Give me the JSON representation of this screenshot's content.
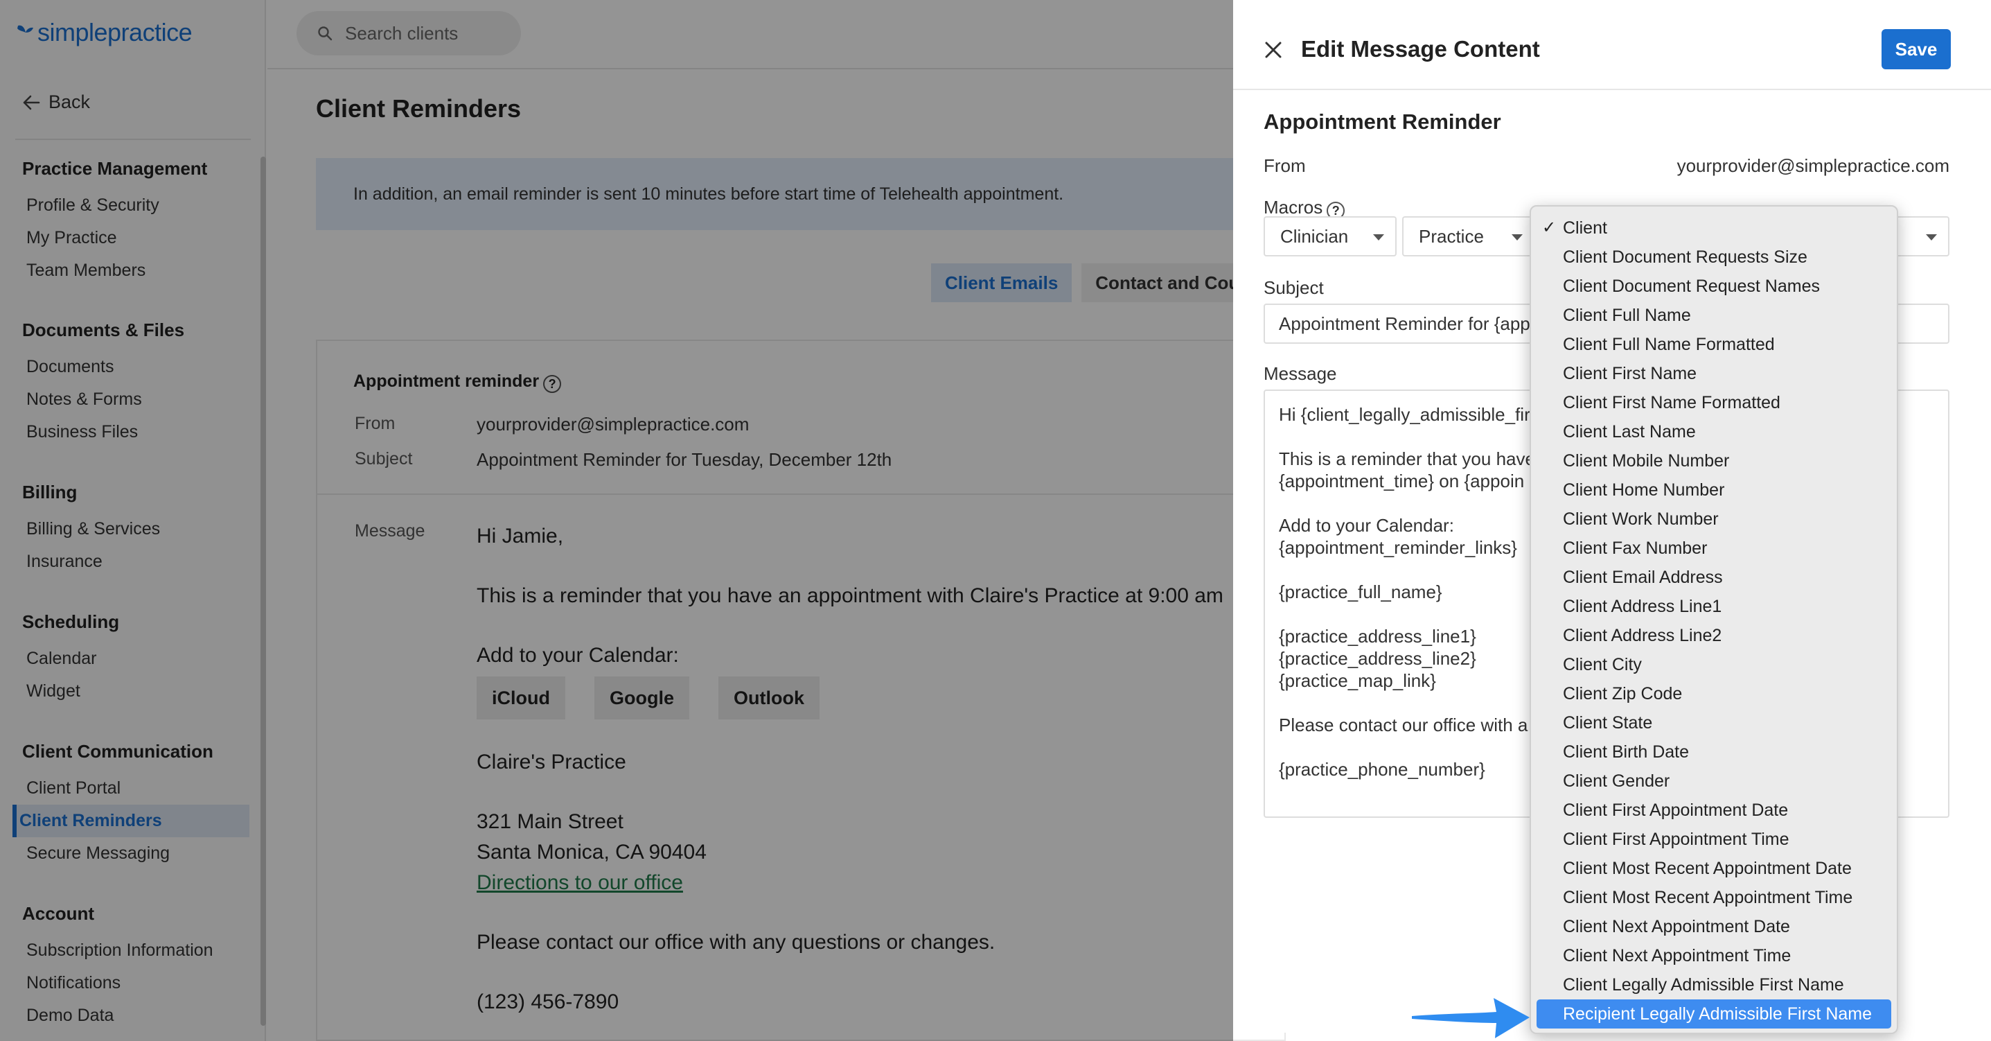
{
  "app": {
    "brand": "simplepractice",
    "brand_light": "simple",
    "brand_bold": "practice",
    "back_label": "Back",
    "search_placeholder": "Search clients"
  },
  "sidebar": {
    "sections": [
      {
        "title": "Practice Management",
        "items": [
          "Profile & Security",
          "My Practice",
          "Team Members"
        ]
      },
      {
        "title": "Documents & Files",
        "items": [
          "Documents",
          "Notes & Forms",
          "Business Files"
        ]
      },
      {
        "title": "Billing",
        "items": [
          "Billing & Services",
          "Insurance"
        ]
      },
      {
        "title": "Scheduling",
        "items": [
          "Calendar",
          "Widget"
        ]
      },
      {
        "title": "Client Communication",
        "items": [
          "Client Portal",
          "Client Reminders",
          "Secure Messaging"
        ]
      },
      {
        "title": "Account",
        "items": [
          "Subscription Information",
          "Notifications",
          "Demo Data"
        ]
      }
    ],
    "active_item": "Client Reminders"
  },
  "main": {
    "title": "Client Reminders",
    "banner": "In addition, an email reminder is sent 10 minutes before start time of Telehealth appointment.",
    "tabs": [
      "Client Emails",
      "Contact and Coup"
    ],
    "card": {
      "heading": "Appointment reminder",
      "help": "?",
      "from_label": "From",
      "from_value": "yourprovider@simplepractice.com",
      "subject_label": "Subject",
      "subject_value": "Appointment Reminder for Tuesday, December 12th",
      "message_label": "Message",
      "greeting": "Hi Jamie,",
      "body_line": "This is a reminder that you have an appointment with Claire's Practice at 9:00 am",
      "calendar_label": "Add to your Calendar:",
      "calendar_buttons": [
        "iCloud",
        "Google",
        "Outlook"
      ],
      "practice_name": "Claire's Practice",
      "address_line1": "321 Main Street",
      "address_line2": "Santa Monica, CA 90404",
      "directions_link": "Directions to our office",
      "contact_line": "Please contact our office with any questions or changes.",
      "phone": "(123) 456-7890"
    }
  },
  "drawer": {
    "title": "Edit Message Content",
    "save_label": "Save",
    "section_title": "Appointment Reminder",
    "from_label": "From",
    "from_value": "yourprovider@simplepractice.com",
    "macros_label": "Macros",
    "macros_help": "?",
    "macro_selects": [
      "Clinician",
      "Practice"
    ],
    "subject_label": "Subject",
    "subject_value": "Appointment Reminder for {app",
    "message_label": "Message",
    "message_lines": [
      "Hi {client_legally_admissible_fir",
      "",
      "This is a reminder that you have",
      "{appointment_time} on {appoin",
      "",
      "Add to your Calendar:",
      "{appointment_reminder_links}",
      "",
      "{practice_full_name}",
      "",
      "{practice_address_line1}",
      "{practice_address_line2}",
      "{practice_map_link}",
      "",
      "Please contact our office with a",
      "",
      "{practice_phone_number}"
    ]
  },
  "dropdown": {
    "selected": "Client",
    "highlighted": "Recipient Legally Admissible First Name",
    "options": [
      "Client",
      "Client Document Requests Size",
      "Client Document Request Names",
      "Client Full Name",
      "Client Full Name Formatted",
      "Client First Name",
      "Client First Name Formatted",
      "Client Last Name",
      "Client Mobile Number",
      "Client Home Number",
      "Client Work Number",
      "Client Fax Number",
      "Client Email Address",
      "Client Address Line1",
      "Client Address Line2",
      "Client City",
      "Client Zip Code",
      "Client State",
      "Client Birth Date",
      "Client Gender",
      "Client First Appointment Date",
      "Client First Appointment Time",
      "Client Most Recent Appointment Date",
      "Client Most Recent Appointment Time",
      "Client Next Appointment Date",
      "Client Next Appointment Time",
      "Client Legally Admissible First Name",
      "Recipient Legally Admissible First Name"
    ]
  },
  "colors": {
    "brand": "#1b6fcf",
    "banner_bg": "#e4eefb",
    "highlight": "#3e8cf0",
    "annotation_arrow": "#2f8cf0",
    "link": "#1f7a4a"
  },
  "icons": {
    "search": "search-icon",
    "back": "arrow-left-icon",
    "close": "close-icon",
    "help": "question-circle-icon",
    "check": "checkmark-icon",
    "annotation": "pointer-arrow-icon"
  }
}
